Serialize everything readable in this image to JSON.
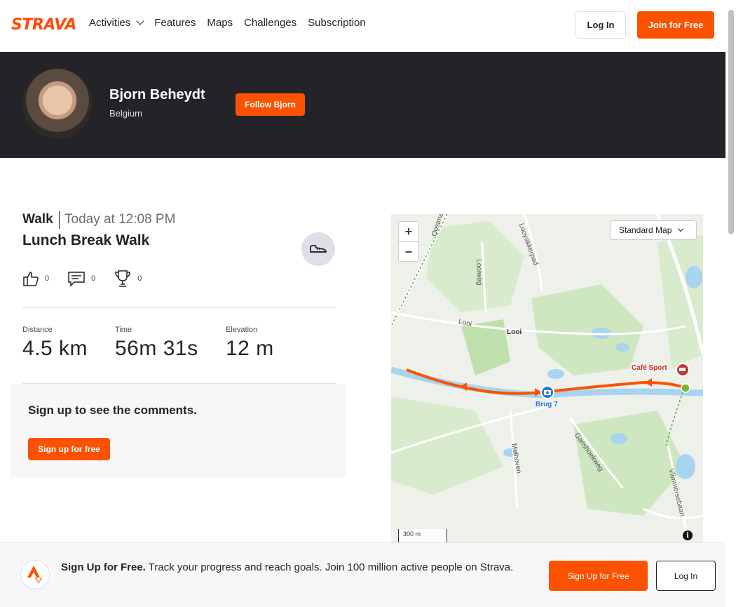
{
  "nav": {
    "logo": "STRAVA",
    "items": [
      "Activities",
      "Features",
      "Maps",
      "Challenges",
      "Subscription"
    ],
    "login": "Log In",
    "join": "Join for Free"
  },
  "athlete": {
    "name": "Bjorn Beheydt",
    "location": "Belgium",
    "follow": "Follow Bjorn"
  },
  "activity": {
    "type": "Walk",
    "time": "Today at 12:08 PM",
    "title": "Lunch Break Walk",
    "kudos": "0",
    "comments": "0",
    "achievements": "0",
    "stats": [
      {
        "label": "Distance",
        "value": "4.5 km"
      },
      {
        "label": "Time",
        "value": "56m 31s"
      },
      {
        "label": "Elevation",
        "value": "12 m"
      }
    ]
  },
  "comments": {
    "title": "Sign up to see the comments.",
    "button": "Sign up for free"
  },
  "map": {
    "style": "Standard Map",
    "scale": "300 m",
    "labels": {
      "oostmalsesteenweg": "Oostmalses",
      "looyakkerpad": "Looyakkerpad",
      "looiweg": "Looiweg",
      "looi_road": "Looi",
      "looi": "Looi",
      "cafe": "Café Sport",
      "brug": "Brug 7",
      "melhoven": "Melhoven",
      "ganshoek": "Ganshoekweg",
      "vlimmersebaan": "Vlimmersebaan"
    },
    "zoom_in": "+",
    "zoom_out": "−",
    "info": "i"
  },
  "bottom": {
    "headline": "Sign Up for Free.",
    "text": "Track your progress and reach goals. Join 100 million active people on Strava.",
    "signup": "Sign Up for Free",
    "login": "Log In"
  }
}
